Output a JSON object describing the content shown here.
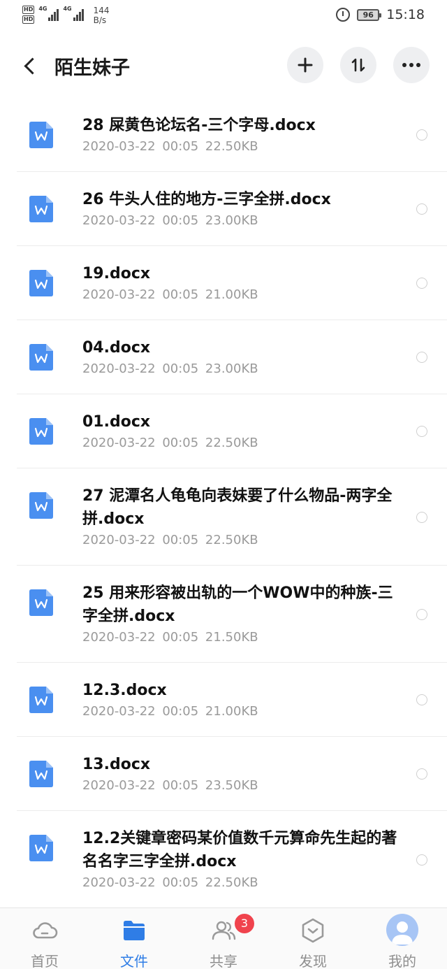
{
  "status_bar": {
    "hd1": "HD",
    "hd2": "HD",
    "net1": "4G",
    "net2": "4G",
    "speed_value": "144",
    "speed_unit": "B/s",
    "battery": "96",
    "time": "15:18"
  },
  "header": {
    "title": "陌生妹子"
  },
  "files": [
    {
      "name": "28 屎黄色论坛名-三个字母.docx",
      "meta": "2020-03-22 00:05 22.50KB"
    },
    {
      "name": "26 牛头人住的地方-三字全拼.docx",
      "meta": "2020-03-22 00:05 23.00KB"
    },
    {
      "name": "19.docx",
      "meta": "2020-03-22 00:05 21.00KB"
    },
    {
      "name": "04.docx",
      "meta": "2020-03-22 00:05 23.00KB"
    },
    {
      "name": "01.docx",
      "meta": "2020-03-22 00:05 22.50KB"
    },
    {
      "name": "27 泥潭名人龟龟向表妹要了什么物品-两字全拼.docx",
      "meta": "2020-03-22 00:05 22.50KB"
    },
    {
      "name": "25 用来形容被出轨的一个WOW中的种族-三字全拼.docx",
      "meta": "2020-03-22 00:05 21.50KB"
    },
    {
      "name": "12.3.docx",
      "meta": "2020-03-22 00:05 21.00KB"
    },
    {
      "name": "13.docx",
      "meta": "2020-03-22 00:05 23.50KB"
    },
    {
      "name": "12.2关键章密码某价值数千元算命先生起的著名名字三字全拼.docx",
      "meta": "2020-03-22 00:05 22.50KB"
    }
  ],
  "bottom_nav": {
    "items": [
      {
        "label": "首页",
        "icon": "cloud-icon"
      },
      {
        "label": "文件",
        "icon": "folder-icon"
      },
      {
        "label": "共享",
        "icon": "people-icon"
      },
      {
        "label": "发现",
        "icon": "discover-icon"
      },
      {
        "label": "我的",
        "icon": "avatar-icon"
      }
    ],
    "share_badge": "3"
  },
  "colors": {
    "accent": "#2f7de6",
    "badge": "#f0434d",
    "doc_icon": "#4a8ff0"
  }
}
